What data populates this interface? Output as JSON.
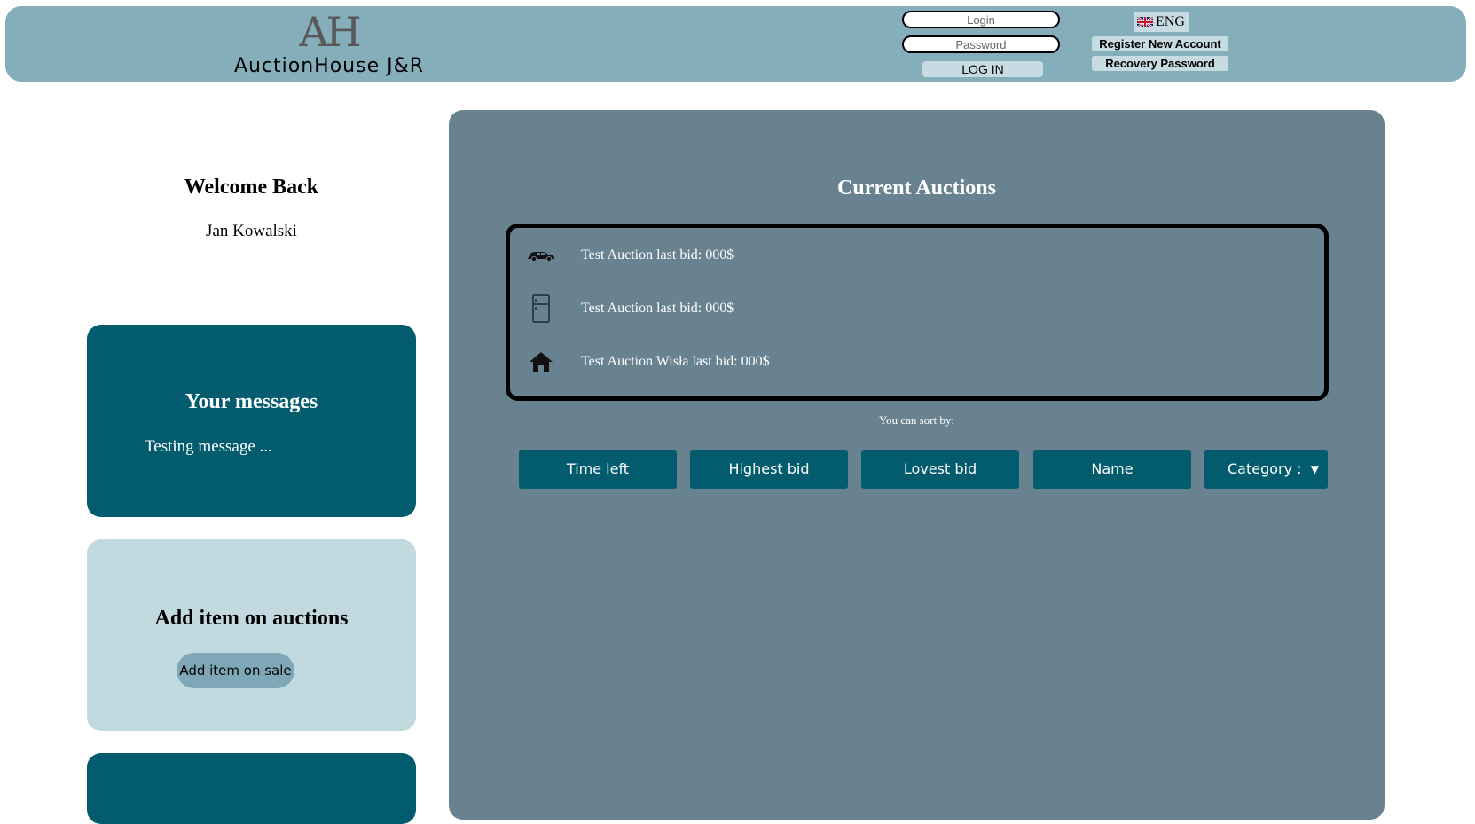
{
  "header": {
    "logo_mark": "AH",
    "logo_name": "AuctionHouse J&R",
    "login_placeholder": "Login",
    "password_placeholder": "Password",
    "login_button": "LOG IN",
    "language": "ENG",
    "register_link": "Register New Account",
    "recovery_link": "Recovery Password",
    "background_color": "#85aebb"
  },
  "sidebar": {
    "welcome_title": "Welcome Back",
    "user_name": "Jan Kowalski",
    "messages_title": "Your messages",
    "message_preview": "Testing message ...",
    "add_item_title": "Add item on auctions",
    "add_item_button": "Add item on sale",
    "accent_color": "#035c6e"
  },
  "main": {
    "title": "Current Auctions",
    "auctions": [
      {
        "icon": "car-icon",
        "text": "Test Auction last bid: 000$"
      },
      {
        "icon": "fridge-icon",
        "text": "Test Auction last bid: 000$"
      },
      {
        "icon": "house-icon",
        "text": "Test Auction Wisła last bid: 000$"
      }
    ],
    "sort_label": "You can sort by:",
    "sort_options": [
      "Time left",
      "Highest bid",
      "Lovest bid",
      "Name"
    ],
    "category_select": "Category :",
    "panel_color": "#68838f"
  }
}
